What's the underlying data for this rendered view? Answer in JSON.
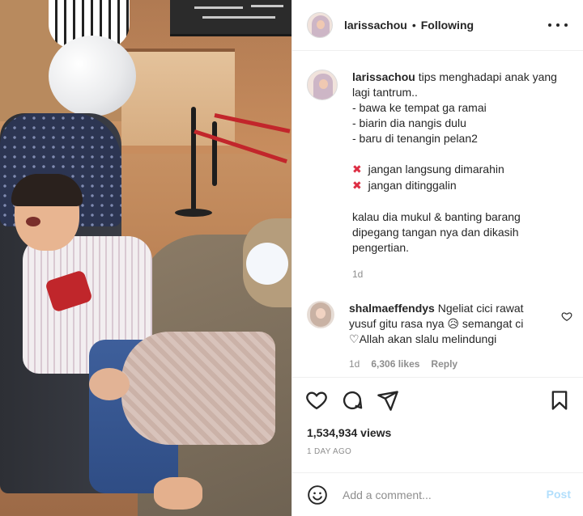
{
  "header": {
    "username": "larissachou",
    "separator": "•",
    "follow_status": "Following",
    "more_icon": "more-horizontal-icon"
  },
  "caption": {
    "username": "larissachou",
    "lines": [
      "tips menghadapi anak yang",
      "lagi tantrum..",
      "- bawa ke tempat ga ramai",
      "- biarin dia nangis dulu",
      "- baru di tenangin pelan2"
    ],
    "dont_marker": "✖",
    "donts": [
      "jangan langsung dimarahin",
      "jangan ditinggalin"
    ],
    "closing_lines": [
      "kalau dia mukul & banting barang",
      "dipegang tangan nya dan dikasih",
      "pengertian."
    ],
    "age": "1d"
  },
  "comment": {
    "username": "shalmaeffendys",
    "text_line1": "Ngeliat cici rawat",
    "text_line2": "yusuf gitu rasa nya",
    "emoji": "😥",
    "text_line2b": "semangat ci",
    "heart_emoji": "♡",
    "text_line3": "Allah akan slalu melindungi",
    "age": "1d",
    "likes": "6,306 likes",
    "reply_label": "Reply"
  },
  "actions": {
    "icons": [
      "heart-icon",
      "comment-icon",
      "share-icon",
      "bookmark-icon"
    ],
    "views": "1,534,934 views",
    "timestamp": "1 DAY AGO"
  },
  "add_comment": {
    "placeholder": "Add a comment...",
    "post_label": "Post",
    "emoji_icon": "smiley-icon"
  },
  "colors": {
    "text": "#262626",
    "muted": "#8e8e8e",
    "border": "#efefef",
    "post_disabled": "#b2dffc",
    "cross": "#dd2e44"
  }
}
